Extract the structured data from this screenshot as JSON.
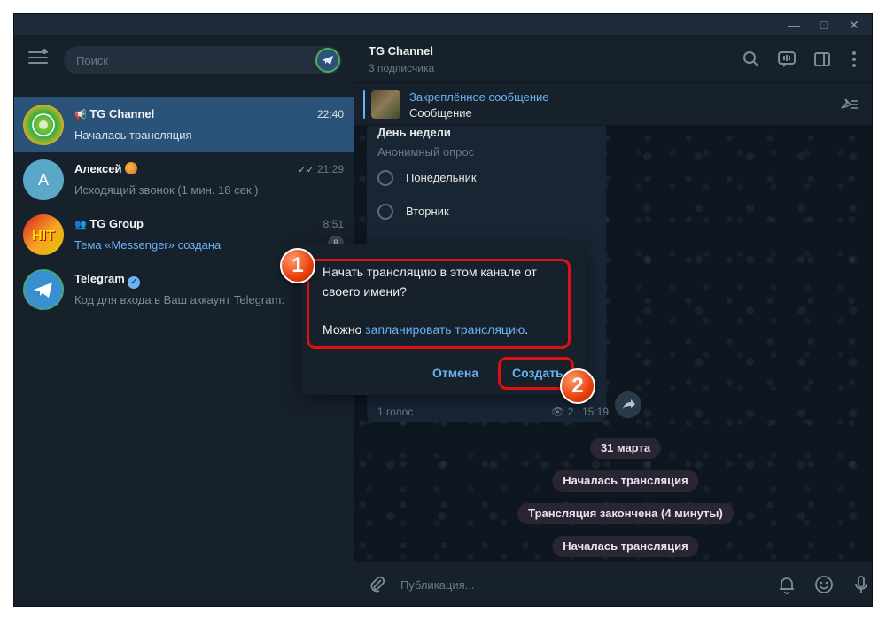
{
  "search": {
    "placeholder": "Поиск"
  },
  "chats": [
    {
      "title": "TG Channel",
      "time": "22:40",
      "preview": "Началась трансляция"
    },
    {
      "title": "Алексей",
      "time": "21:29",
      "preview": "Исходящий звонок (1 мин. 18 сек.)",
      "avatar_letter": "А"
    },
    {
      "title": "TG Group",
      "time": "8:51",
      "preview": "Тема «Messenger» создана",
      "badge": "8"
    },
    {
      "title": "Telegram",
      "preview": "Код для входа в Ваш аккаунт Telegram:"
    }
  ],
  "header": {
    "title": "TG Channel",
    "subscribers": "3 подписчика"
  },
  "pinned": {
    "title": "Закреплённое сообщение",
    "subtitle": "Сообщение"
  },
  "poll": {
    "question": "День недели",
    "type": "Анонимный опрос",
    "options": [
      "Понедельник",
      "Вторник"
    ],
    "votes": "1 голос",
    "views": "2",
    "time": "15:19"
  },
  "service_messages": [
    "31 марта",
    "Началась трансляция",
    "Трансляция закончена (4 минуты)",
    "Началась трансляция"
  ],
  "composer": {
    "placeholder": "Публикация..."
  },
  "dialog": {
    "text": "Начать трансляцию в этом канале от своего имени?",
    "text2_prefix": "Можно ",
    "schedule_link": "запланировать трансляцию",
    "text2_suffix": ".",
    "cancel_label": "Отмена",
    "create_label": "Создать"
  },
  "annotations": {
    "step1": "1",
    "step2": "2"
  },
  "colors": {
    "accent": "#6ab3f3",
    "active_chat": "#2b5278",
    "highlight": "#e01010"
  }
}
